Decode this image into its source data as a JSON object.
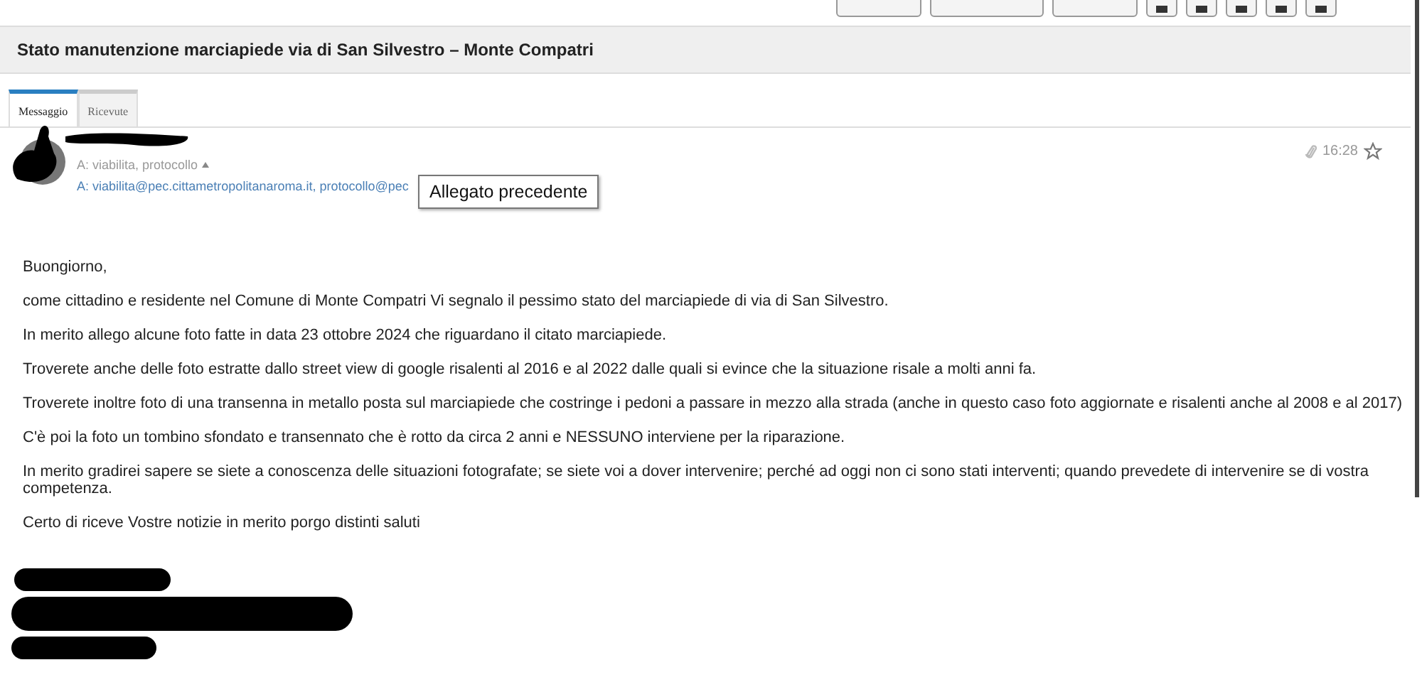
{
  "toolbar": {
    "buttons": [
      {
        "kind": "wide"
      },
      {
        "kind": "wide"
      },
      {
        "kind": "wide"
      },
      {
        "kind": "icon"
      },
      {
        "kind": "icon"
      },
      {
        "kind": "icon"
      },
      {
        "kind": "icon"
      },
      {
        "kind": "icon"
      }
    ]
  },
  "subject": "Stato manutenzione marciapiede via di San Silvestro – Monte Compatri",
  "tabs": [
    {
      "label": "Messaggio",
      "selected": true
    },
    {
      "label": "Ricevute",
      "selected": false
    }
  ],
  "header": {
    "to_short": "A: viabilita, protocollo",
    "to_full": "A: viabilita@pec.cittametropolitanaroma.it, protocollo@pec",
    "time": "16:28",
    "attachment": true,
    "starred": false,
    "tooltip": "Allegato precedente"
  },
  "body": [
    "Buongiorno,",
    "come cittadino e residente nel Comune di Monte Compatri Vi segnalo il pessimo stato del marciapiede di via di San Silvestro.",
    "In merito allego alcune foto fatte in data 23 ottobre 2024 che riguardano il citato marciapiede.",
    "Troverete anche delle foto estratte dallo street view di google risalenti al 2016 e al 2022 dalle quali si evince che la situazione risale a molti anni fa.",
    "Troverete inoltre foto di una transenna in metallo posta sul marciapiede che costringe i pedoni a passare in mezzo alla strada  (anche in questo caso foto aggiornate e risalenti anche al 2008 e al 2017)",
    "C'è poi la foto un tombino sfondato e transennato che è rotto da circa 2 anni e NESSUNO interviene per la riparazione.",
    "In merito gradirei sapere se siete a conoscenza delle situazioni fotografate; se siete voi a dover intervenire; perché ad oggi non ci sono stati interventi; quando prevedete di intervenire se di vostra competenza.",
    "Certo di riceve Vostre notizie in merito porgo distinti saluti"
  ]
}
